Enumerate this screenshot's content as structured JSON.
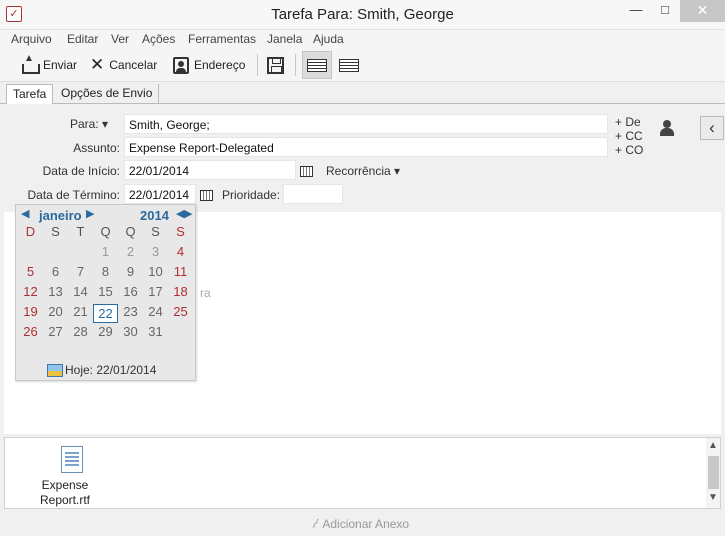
{
  "window": {
    "title": "Tarefa Para: Smith, George",
    "minimize": "—",
    "maximize": "□",
    "close": "✕",
    "app_icon": "✓"
  },
  "menu": [
    "Arquivo",
    "Editar",
    "Ver",
    "Ações",
    "Ferramentas",
    "Janela",
    "Ajuda"
  ],
  "toolbar": {
    "send": "Enviar",
    "cancel": "Cancelar",
    "address": "Endereço"
  },
  "tabs": [
    "Tarefa",
    "Opções de Envio"
  ],
  "form": {
    "to_label": "Para:",
    "to_dropdown": "▾",
    "to_value": "Smith, George;",
    "subject_label": "Assunto:",
    "subject_value": "Expense Report-Delegated",
    "start_label": "Data de Início:",
    "start_value": "22/01/2014",
    "recurrence": "Recorrência",
    "recurrence_arrow": "▾",
    "due_label": "Data de Término:",
    "due_value": "22/01/2014",
    "priority_label": "Prioridade:",
    "priority_value": "",
    "from_opt": "+ De",
    "cc_opt": "+ CC",
    "bcc_opt": "+ CO",
    "side_toggle": "‹"
  },
  "body": {
    "ghost_text": "ra"
  },
  "calendar": {
    "prev": "◀",
    "next": "▶",
    "month": "janeiro",
    "year": "2014",
    "dow": [
      "D",
      "S",
      "T",
      "Q",
      "Q",
      "S",
      "S"
    ],
    "weeks": [
      [
        "",
        "",
        "",
        "1",
        "2",
        "3",
        "4"
      ],
      [
        "5",
        "6",
        "7",
        "8",
        "9",
        "10",
        "11"
      ],
      [
        "12",
        "13",
        "14",
        "15",
        "16",
        "17",
        "18"
      ],
      [
        "19",
        "20",
        "21",
        "22",
        "23",
        "24",
        "25"
      ],
      [
        "26",
        "27",
        "28",
        "29",
        "30",
        "31",
        ""
      ]
    ],
    "selected_day": "22",
    "today_label": "Hoje: 22/01/2014"
  },
  "attachments": {
    "files": [
      "Expense Report.rtf"
    ],
    "add_label": "Adicionar Anexo",
    "scroll_up": "▲",
    "scroll_down": "▼"
  },
  "colors": {
    "accent": "#2a6a9e",
    "weekend": "#b03030"
  }
}
